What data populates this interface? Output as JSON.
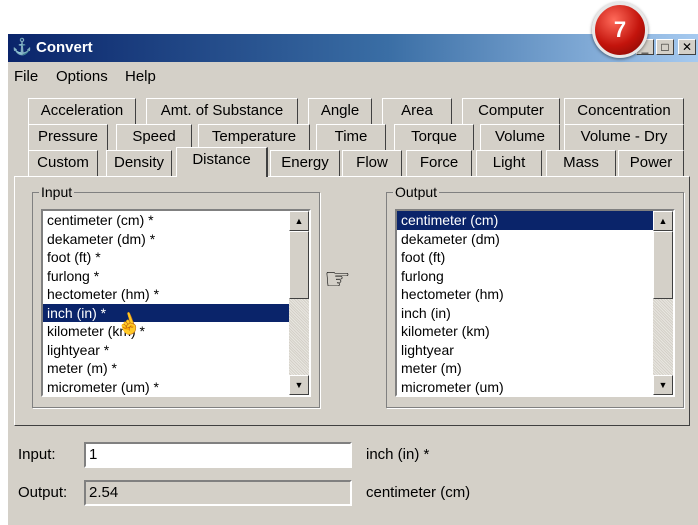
{
  "window": {
    "title": "Convert",
    "step_badge": "7"
  },
  "menu": [
    "File",
    "Options",
    "Help"
  ],
  "tabs": {
    "row1": [
      "Acceleration",
      "Amt. of Substance",
      "Angle",
      "Area",
      "Computer",
      "Concentration"
    ],
    "row2": [
      "Pressure",
      "Speed",
      "Temperature",
      "Time",
      "Torque",
      "Volume",
      "Volume - Dry"
    ],
    "row3": [
      "Custom",
      "Density",
      "Distance",
      "Energy",
      "Flow",
      "Force",
      "Light",
      "Mass",
      "Power"
    ],
    "active": "Distance"
  },
  "input_group": {
    "label": "Input",
    "items": [
      "centimeter (cm) *",
      "dekameter (dm) *",
      "foot (ft) *",
      "furlong *",
      "hectometer (hm) *",
      "inch (in) *",
      "kilometer (km) *",
      "lightyear *",
      "meter (m) *",
      "micrometer (um) *"
    ],
    "selected_index": 5
  },
  "output_group": {
    "label": "Output",
    "items": [
      "centimeter (cm)",
      "dekameter (dm)",
      "foot (ft)",
      "furlong",
      "hectometer (hm)",
      "inch (in)",
      "kilometer (km)",
      "lightyear",
      "meter (m)",
      "micrometer (um)"
    ],
    "selected_index": 0
  },
  "convert_icon": "pointing-hand-icon",
  "fields": {
    "input_label": "Input:",
    "input_value": "1",
    "input_unit": "inch (in) *",
    "output_label": "Output:",
    "output_value": "2.54",
    "output_unit": "centimeter (cm)"
  },
  "colors": {
    "selection": "#0a246a",
    "titlebar": "#0a246a",
    "badge": "#c3140c"
  }
}
